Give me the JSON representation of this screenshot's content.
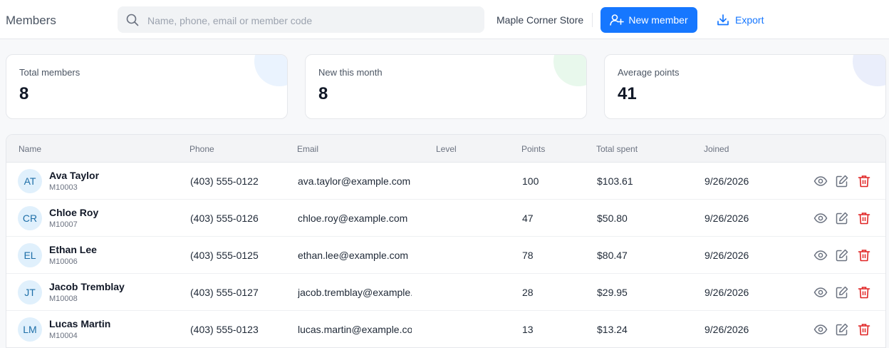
{
  "header": {
    "title": "Members",
    "search_placeholder": "Name, phone, email or member code",
    "search_value": "",
    "store_name": "Maple Corner Store",
    "new_member_label": "New member",
    "export_label": "Export"
  },
  "stats": [
    {
      "label": "Total members",
      "value": "8",
      "accent": "#eaf3fe"
    },
    {
      "label": "New this month",
      "value": "8",
      "accent": "#e8f8ec"
    },
    {
      "label": "Average points",
      "value": "41",
      "accent": "#eaeefb"
    }
  ],
  "table": {
    "columns": {
      "name": "Name",
      "phone": "Phone",
      "email": "Email",
      "level": "Level",
      "points": "Points",
      "spent": "Total spent",
      "joined": "Joined"
    },
    "rows": [
      {
        "initials": "AT",
        "name": "Ava Taylor",
        "code": "M10003",
        "phone": "(403) 555-0122",
        "email": "ava.taylor@example.com",
        "level": "",
        "points": "100",
        "spent": "$103.61",
        "joined": "9/26/2026"
      },
      {
        "initials": "CR",
        "name": "Chloe Roy",
        "code": "M10007",
        "phone": "(403) 555-0126",
        "email": "chloe.roy@example.com",
        "level": "",
        "points": "47",
        "spent": "$50.80",
        "joined": "9/26/2026"
      },
      {
        "initials": "EL",
        "name": "Ethan Lee",
        "code": "M10006",
        "phone": "(403) 555-0125",
        "email": "ethan.lee@example.com",
        "level": "",
        "points": "78",
        "spent": "$80.47",
        "joined": "9/26/2026"
      },
      {
        "initials": "JT",
        "name": "Jacob Tremblay",
        "code": "M10008",
        "phone": "(403) 555-0127",
        "email": "jacob.tremblay@example.com",
        "level": "",
        "points": "28",
        "spent": "$29.95",
        "joined": "9/26/2026"
      },
      {
        "initials": "LM",
        "name": "Lucas Martin",
        "code": "M10004",
        "phone": "(403) 555-0123",
        "email": "lucas.martin@example.com",
        "level": "",
        "points": "13",
        "spent": "$13.24",
        "joined": "9/26/2026"
      }
    ],
    "row_actions": [
      "eye-icon",
      "edit-icon",
      "trash-icon"
    ]
  },
  "colors": {
    "primary": "#1677ff",
    "danger": "#e02424",
    "avatar_bg": "#e0f0fc",
    "avatar_text": "#1e6fa8"
  }
}
